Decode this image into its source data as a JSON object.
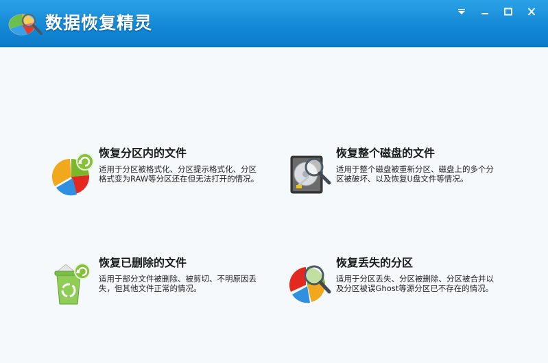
{
  "app": {
    "title": "数据恢复精灵"
  },
  "window_controls": {
    "menu_icon": "dropdown-triangle-icon",
    "minimize_icon": "minimize-icon",
    "maximize_icon": "maximize-icon",
    "close_icon": "close-icon"
  },
  "colors": {
    "titlebar": "#1489d6",
    "background": "#f5f9fc",
    "text": "#1a1a1a"
  },
  "options": [
    {
      "id": "partition",
      "title": "恢复分区内的文件",
      "description": "适用于分区被格式化、分区提示格式化、分区格式变为RAW等分区还在但无法打开的情况。",
      "icon": "pie-chart-refresh-icon"
    },
    {
      "id": "disk",
      "title": "恢复整个磁盘的文件",
      "description": "适用于整个磁盘被重新分区、磁盘上的多个分区被破坏、以及恢复U盘文件等情况。",
      "icon": "hard-disk-magnifier-icon"
    },
    {
      "id": "deleted",
      "title": "恢复已删除的文件",
      "description": "适用于部分文件被删除、被剪切、不明原因丢失，但其他文件正常的情况。",
      "icon": "recycle-bin-icon"
    },
    {
      "id": "lost",
      "title": "恢复丢失的分区",
      "description": "适用于分区丢失、分区被删除、分区被合并以及分区被误Ghost等源分区已不存在的情况。",
      "icon": "pie-chart-magnifier-icon"
    }
  ]
}
